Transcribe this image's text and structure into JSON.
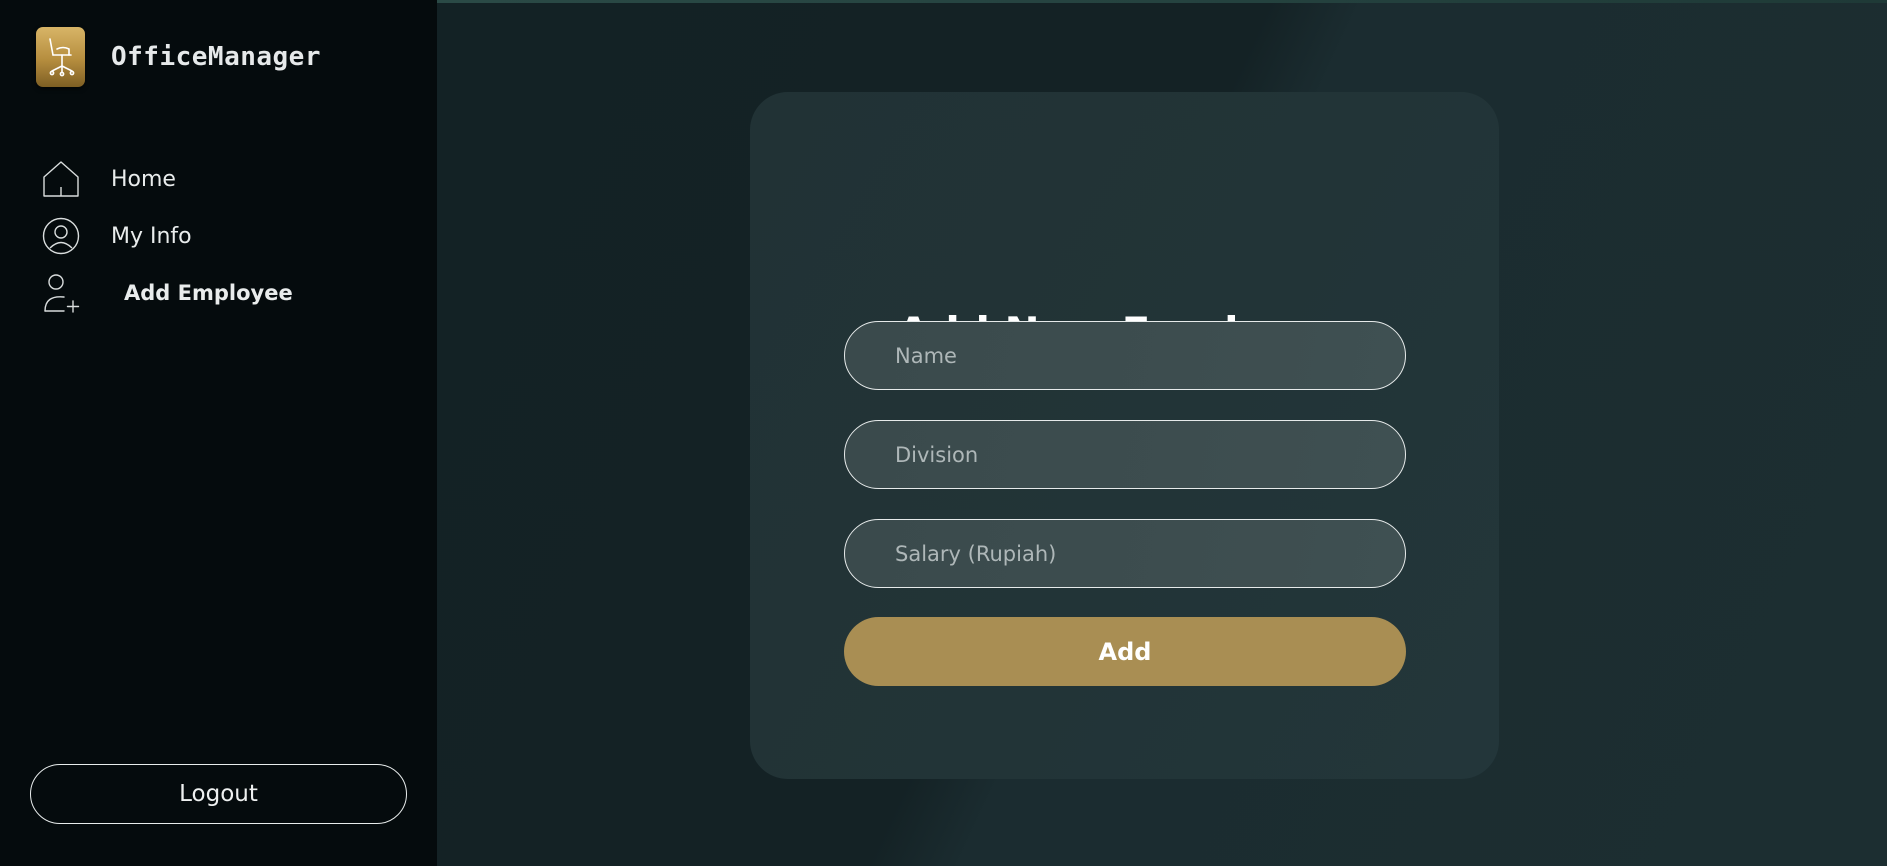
{
  "app": {
    "name": "OfficeManager",
    "logo_icon": "office-chair-icon"
  },
  "sidebar": {
    "items": [
      {
        "label": "Home",
        "icon": "home-icon"
      },
      {
        "label": "My Info",
        "icon": "user-circle-icon"
      },
      {
        "label": "Add Employee",
        "icon": "user-plus-icon",
        "active": true
      }
    ],
    "logout_label": "Logout"
  },
  "form": {
    "title": "Add New Employee",
    "fields": [
      {
        "placeholder": "Name",
        "value": ""
      },
      {
        "placeholder": "Division",
        "value": ""
      },
      {
        "placeholder": "Salary (Rupiah)",
        "value": ""
      }
    ],
    "submit_label": "Add"
  },
  "colors": {
    "sidebar_bg": "#050b0d",
    "main_bg": "#17252a",
    "card_bg": "#213235",
    "accent_gold": "#a98e53",
    "text_light": "#e9ecec"
  }
}
